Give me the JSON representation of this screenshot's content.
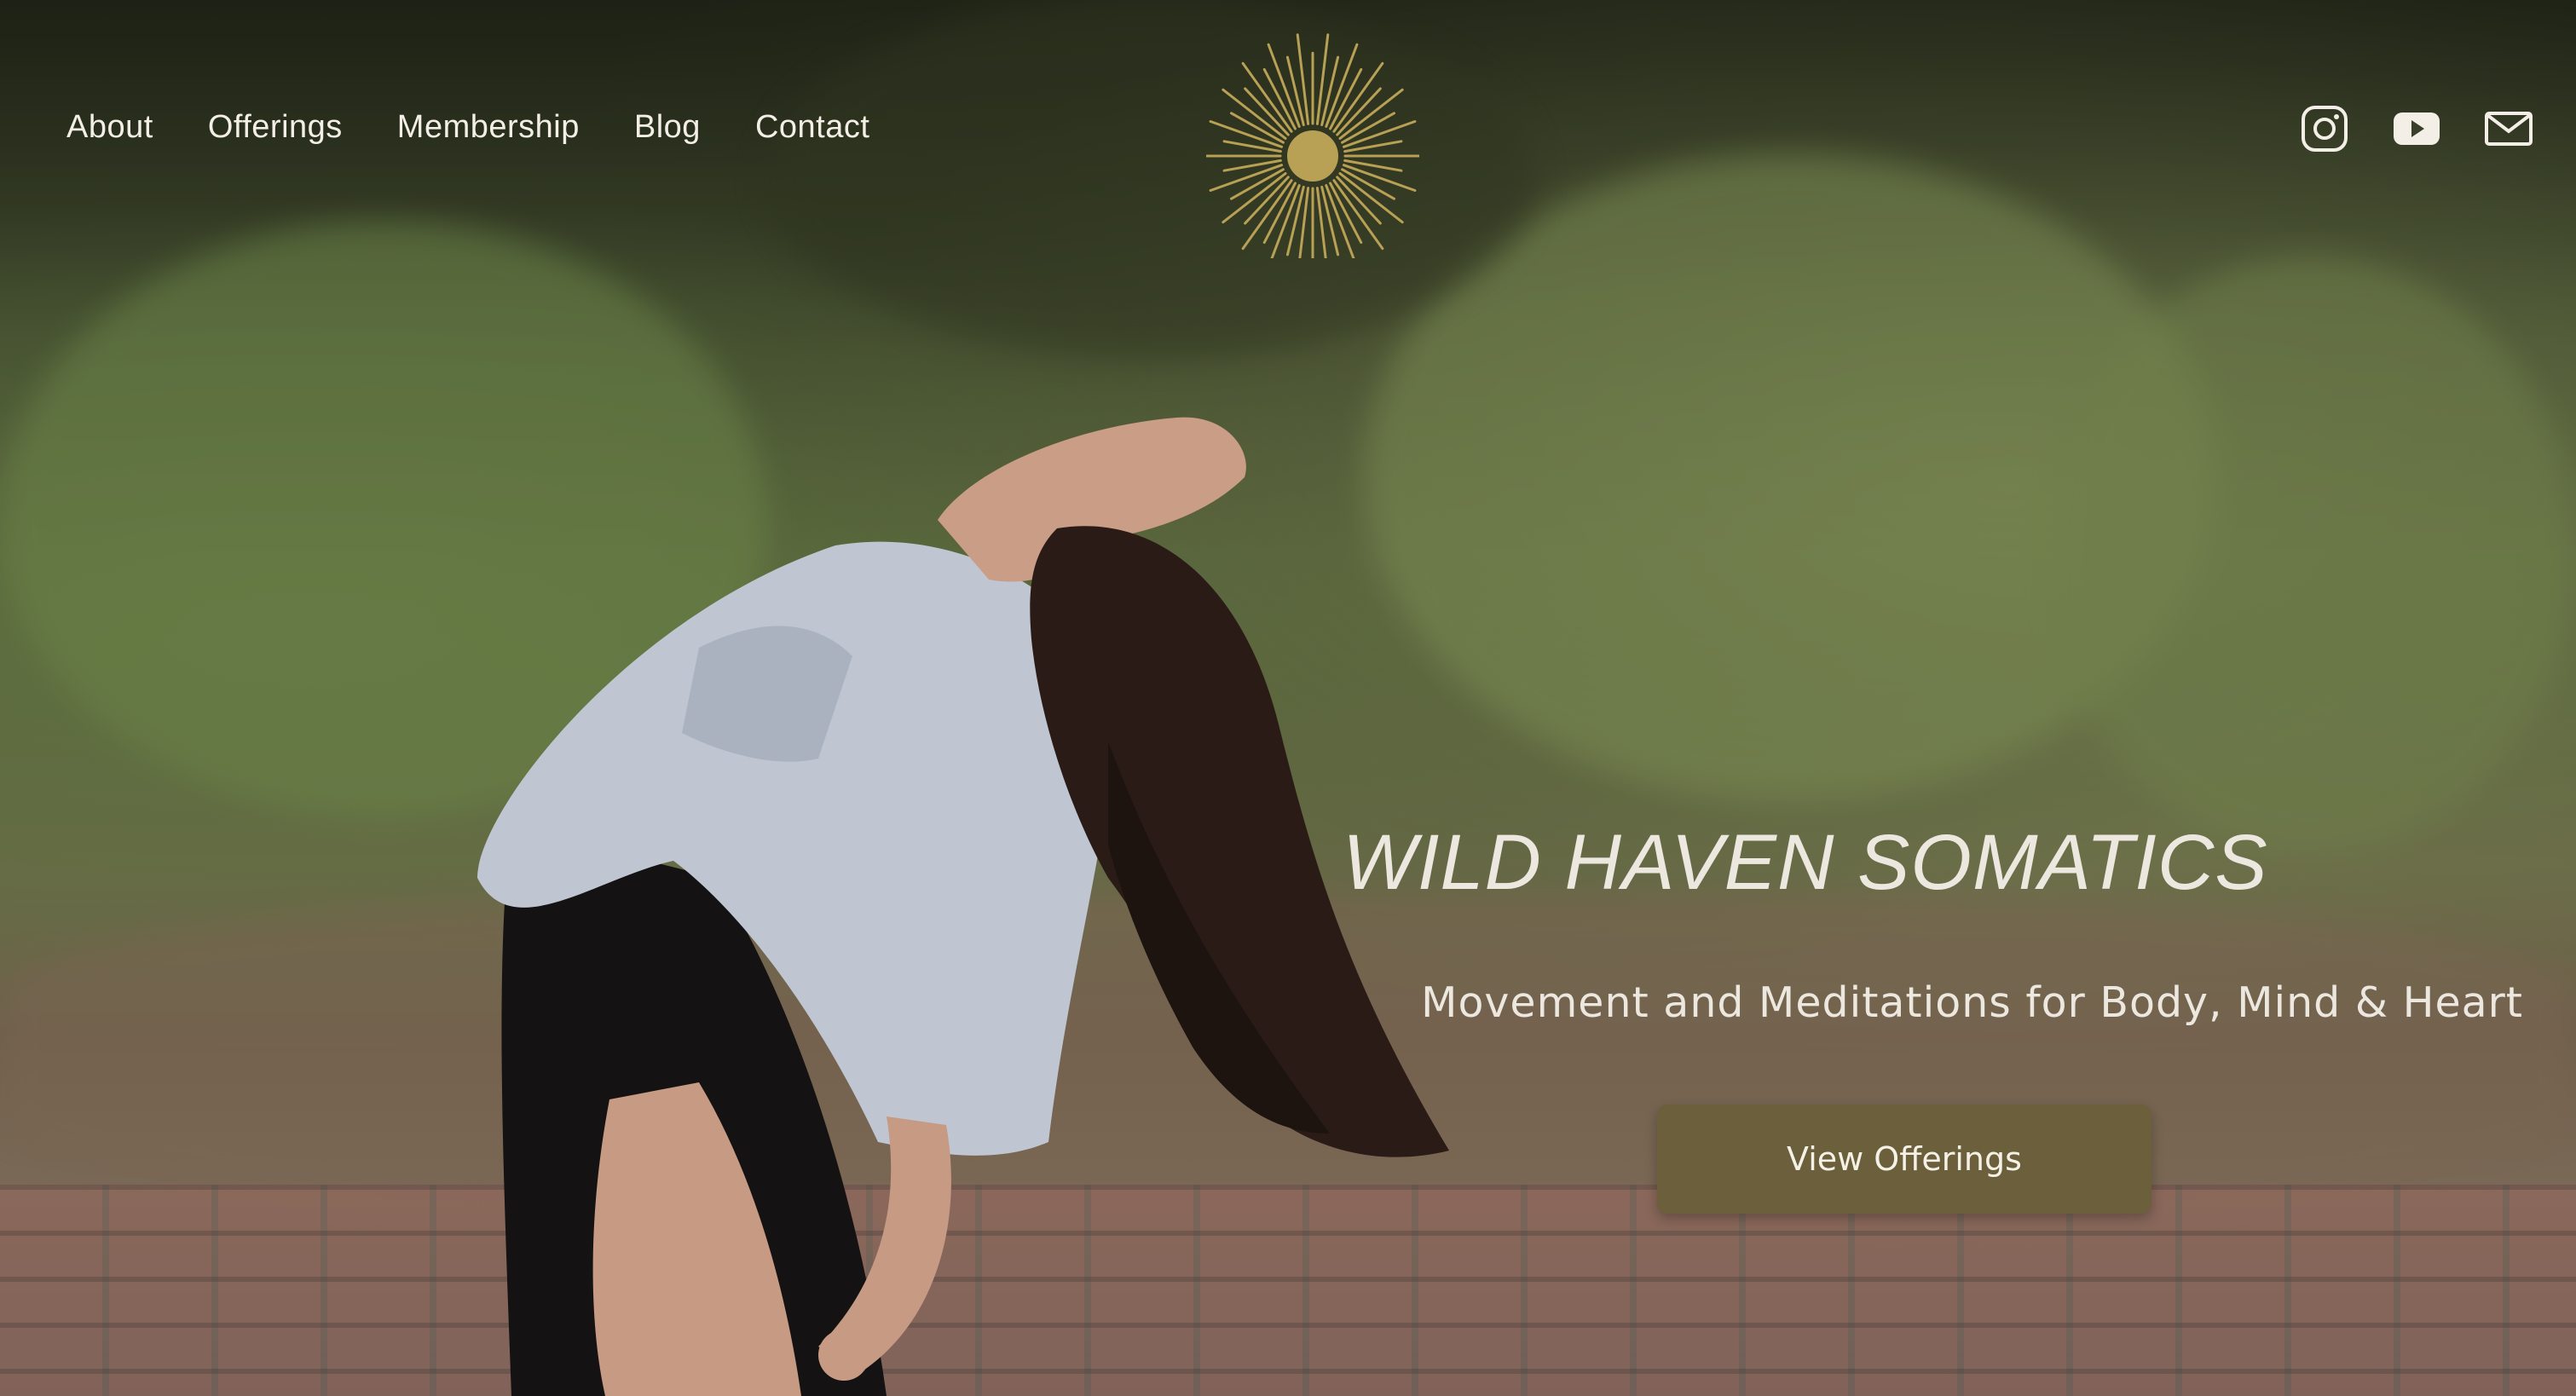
{
  "nav": {
    "items": [
      {
        "label": "About"
      },
      {
        "label": "Offerings"
      },
      {
        "label": "Membership"
      },
      {
        "label": "Blog"
      },
      {
        "label": "Contact"
      }
    ]
  },
  "logo": {
    "icon": "sunburst-logo-icon",
    "color": "#b8a055"
  },
  "social": [
    {
      "icon": "instagram-icon"
    },
    {
      "icon": "youtube-icon"
    },
    {
      "icon": "mail-icon"
    }
  ],
  "hero": {
    "title": "WILD HAVEN SOMATICS",
    "subtitle": "Movement and Meditations for Body, Mind & Heart",
    "cta_label": "View Offerings"
  },
  "colors": {
    "accent": "#6b5f3c",
    "logo_gold": "#b8a055",
    "text_light": "#ece8df"
  }
}
